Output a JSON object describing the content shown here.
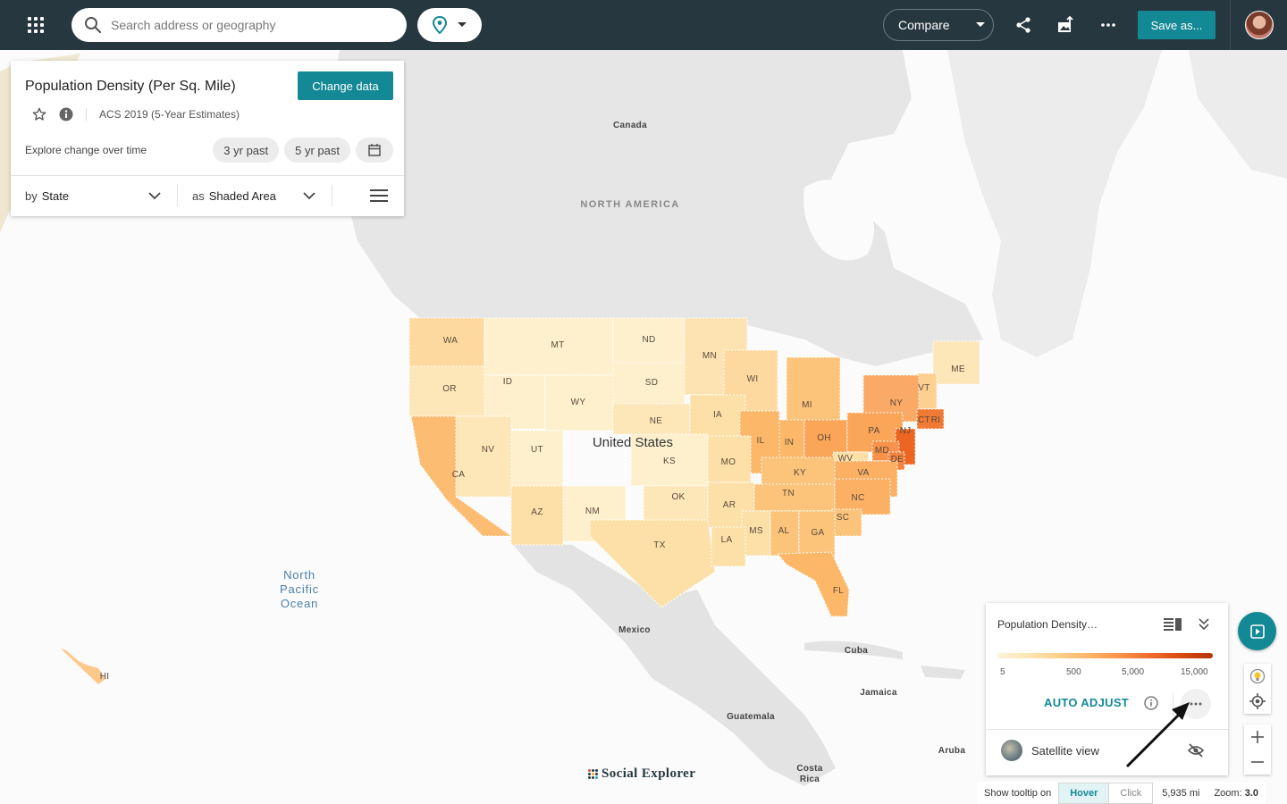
{
  "topbar": {
    "search_placeholder": "Search address or geography",
    "compare_label": "Compare",
    "save_label": "Save as...",
    "icons": [
      "apps-grid-icon",
      "search-icon",
      "map-pin-icon",
      "chevron-down-icon",
      "share-icon",
      "export-image-icon",
      "more-horizontal-icon",
      "user-avatar"
    ]
  },
  "data_panel": {
    "title": "Population Density (Per Sq. Mile)",
    "change_data_label": "Change data",
    "survey": "ACS 2019 (5-Year Estimates)",
    "explore_label": "Explore change over time",
    "time_chips": [
      "3 yr past",
      "5 yr past"
    ],
    "by_prefix": "by",
    "by_value": "State",
    "as_prefix": "as",
    "as_value": "Shaded Area"
  },
  "map_labels": {
    "canada": "Canada",
    "north_america": "NORTH AMERICA",
    "united_states": "United States",
    "mexico": "Mexico",
    "cuba": "Cuba",
    "jamaica": "Jamaica",
    "guatemala": "Guatemala",
    "costa_rica_1": "Costa",
    "costa_rica_2": "Rica",
    "aruba": "Aruba",
    "ocean_1": "North",
    "ocean_2": "Pacific",
    "ocean_3": "Ocean",
    "states": [
      "WA",
      "MT",
      "ND",
      "MN",
      "ME",
      "OR",
      "ID",
      "SD",
      "WI",
      "VT",
      "WY",
      "MI",
      "NY",
      "NE",
      "IA",
      "IL",
      "IN",
      "OH",
      "PA",
      "CT",
      "RI",
      "NJ",
      "NV",
      "UT",
      "KS",
      "MO",
      "MD",
      "DE",
      "WV",
      "CA",
      "KY",
      "VA",
      "TN",
      "OK",
      "AR",
      "NC",
      "AZ",
      "NM",
      "SC",
      "MS",
      "AL",
      "GA",
      "TX",
      "LA",
      "FL",
      "HI"
    ]
  },
  "legend": {
    "title": "Population Density…",
    "ticks": [
      "5",
      "500",
      "5,000",
      "15,000"
    ],
    "auto_adjust_label": "AUTO ADJUST",
    "satellite_label": "Satellite view",
    "colors": [
      "#fdf2d6",
      "#fde6b4",
      "#fdd08a",
      "#fcb466",
      "#f9924a",
      "#f06a2a",
      "#d84a12",
      "#b53408"
    ]
  },
  "bottom_bar": {
    "tooltip_label": "Show tooltip on",
    "hover_label": "Hover",
    "click_label": "Click",
    "scale_label": "5,935 mi",
    "zoom_prefix": "Zoom:",
    "zoom_value": "3.0"
  },
  "brand": {
    "name": "Social Explorer"
  },
  "colors": {
    "topbar": "#263740",
    "accent": "#138995"
  }
}
